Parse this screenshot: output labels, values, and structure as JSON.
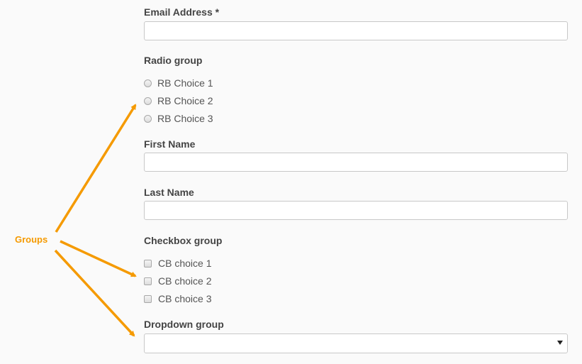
{
  "form": {
    "email": {
      "label": "Email Address *",
      "value": ""
    },
    "radio_group": {
      "label": "Radio group",
      "options": [
        "RB Choice 1",
        "RB Choice 2",
        "RB Choice 3"
      ]
    },
    "first_name": {
      "label": "First Name",
      "value": ""
    },
    "last_name": {
      "label": "Last Name",
      "value": ""
    },
    "checkbox_group": {
      "label": "Checkbox group",
      "options": [
        "CB choice 1",
        "CB choice 2",
        "CB choice 3"
      ]
    },
    "dropdown_group": {
      "label": "Dropdown group",
      "selected": ""
    }
  },
  "annotation": {
    "text": "Groups",
    "color": "#f59a00"
  }
}
